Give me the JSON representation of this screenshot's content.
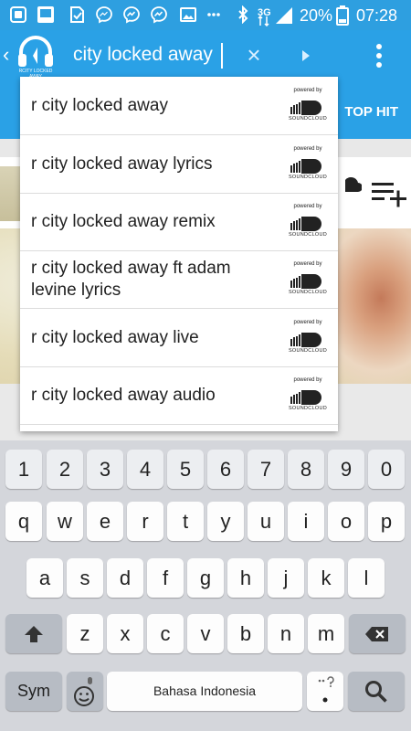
{
  "status_bar": {
    "network": "3G",
    "battery": "20%",
    "time": "07:28"
  },
  "app_bar": {
    "logo_text": "RCITY LOCKED AWAY",
    "search_value": "city locked away",
    "clear_label": "×"
  },
  "tabs": {
    "top_hit": "TOP HIT"
  },
  "suggestions": [
    {
      "text": "r city locked away",
      "badge_top": "powered by",
      "badge_bottom": "SOUNDCLOUD"
    },
    {
      "text": "r city locked away lyrics",
      "badge_top": "powered by",
      "badge_bottom": "SOUNDCLOUD"
    },
    {
      "text": "r city locked away remix",
      "badge_top": "powered by",
      "badge_bottom": "SOUNDCLOUD"
    },
    {
      "text": "r city locked away ft adam levine lyrics",
      "badge_top": "powered by",
      "badge_bottom": "SOUNDCLOUD"
    },
    {
      "text": "r city locked away live",
      "badge_top": "powered by",
      "badge_bottom": "SOUNDCLOUD"
    },
    {
      "text": "r city locked away audio",
      "badge_top": "powered by",
      "badge_bottom": "SOUNDCLOUD"
    }
  ],
  "keyboard": {
    "number_row": [
      "1",
      "2",
      "3",
      "4",
      "5",
      "6",
      "7",
      "8",
      "9",
      "0"
    ],
    "row1": [
      "q",
      "w",
      "e",
      "r",
      "t",
      "y",
      "u",
      "i",
      "o",
      "p"
    ],
    "row2": [
      "a",
      "s",
      "d",
      "f",
      "g",
      "h",
      "j",
      "k",
      "l"
    ],
    "row3": [
      "z",
      "x",
      "c",
      "v",
      "b",
      "n",
      "m"
    ],
    "sym_label": "Sym",
    "space_label": "Bahasa Indonesia"
  },
  "colors": {
    "app_bar": "#2aa1e6",
    "status_bar": "#2e9fe0",
    "keyboard_bg": "#d4d6db"
  }
}
